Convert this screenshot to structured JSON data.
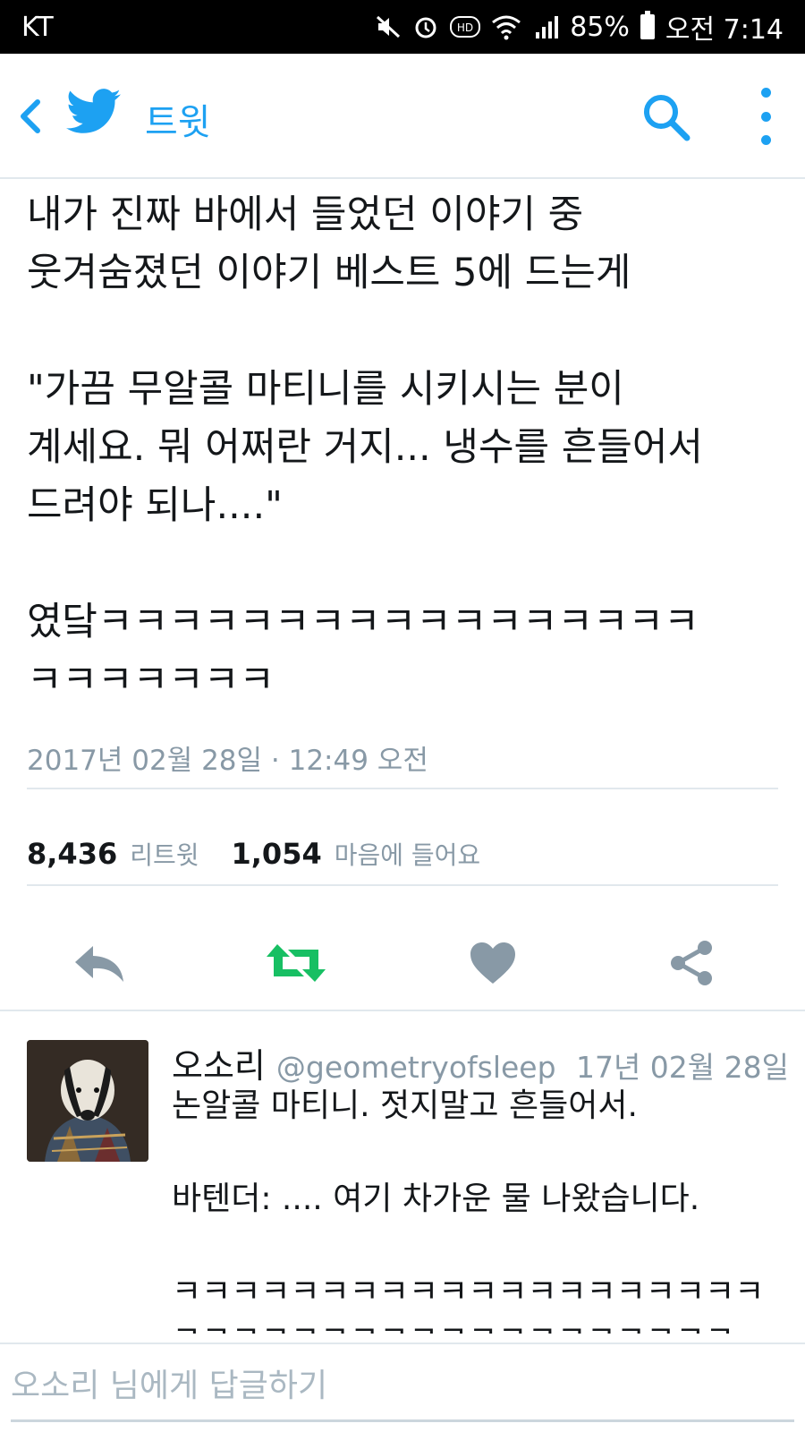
{
  "status_bar": {
    "carrier": "KT",
    "battery": "85%",
    "time": "오전 7:14",
    "icons": [
      "mute-icon",
      "alarm-icon",
      "hd-icon",
      "wifi-icon",
      "signal-icon",
      "battery-icon"
    ]
  },
  "header": {
    "title": "트윗",
    "accent": "#1da1f2"
  },
  "tweet": {
    "text": "내가 진짜 바에서 들었던 이야기 중\n웃겨숨졌던 이야기 베스트 5에 드는게\n\n\"가끔 무알콜 마티니를 시키시는 분이\n계세요. 뭐 어쩌란 거지... 냉수를 흔들어서\n드려야 되나....\"\n\n였닼ㅋㅋㅋㅋㅋㅋㅋㅋㅋㅋㅋㅋㅋㅋㅋㅋㅋ\nㅋㅋㅋㅋㅋㅋㅋ",
    "timestamp": "2017년 02월 28일 · 12:49 오전",
    "retweet_count": "8,436",
    "retweet_label": "리트윗",
    "like_count": "1,054",
    "like_label": "마음에 들어요",
    "retweet_color": "#17bf63",
    "icon_color": "#8899a6"
  },
  "reply": {
    "name": "오소리",
    "handle": "@geometryofsleep",
    "date": "17년 02월 28일",
    "text": "논알콜 마티니. 젓지말고 흔들어서.\n\n바텐더: .... 여기 차가운 물 나왔습니다.\n\nㅋㅋㅋㅋㅋㅋㅋㅋㅋㅋㅋㅋㅋㅋㅋㅋㅋㅋㅋㅋㅋㅋㅋㅋㅋㅋㅋㅋㅋㅋㅋㅋㅋㅋㅋㅋㅋㅋㅋ"
  },
  "reply_box": {
    "placeholder": "오소리 님에게 답글하기"
  }
}
